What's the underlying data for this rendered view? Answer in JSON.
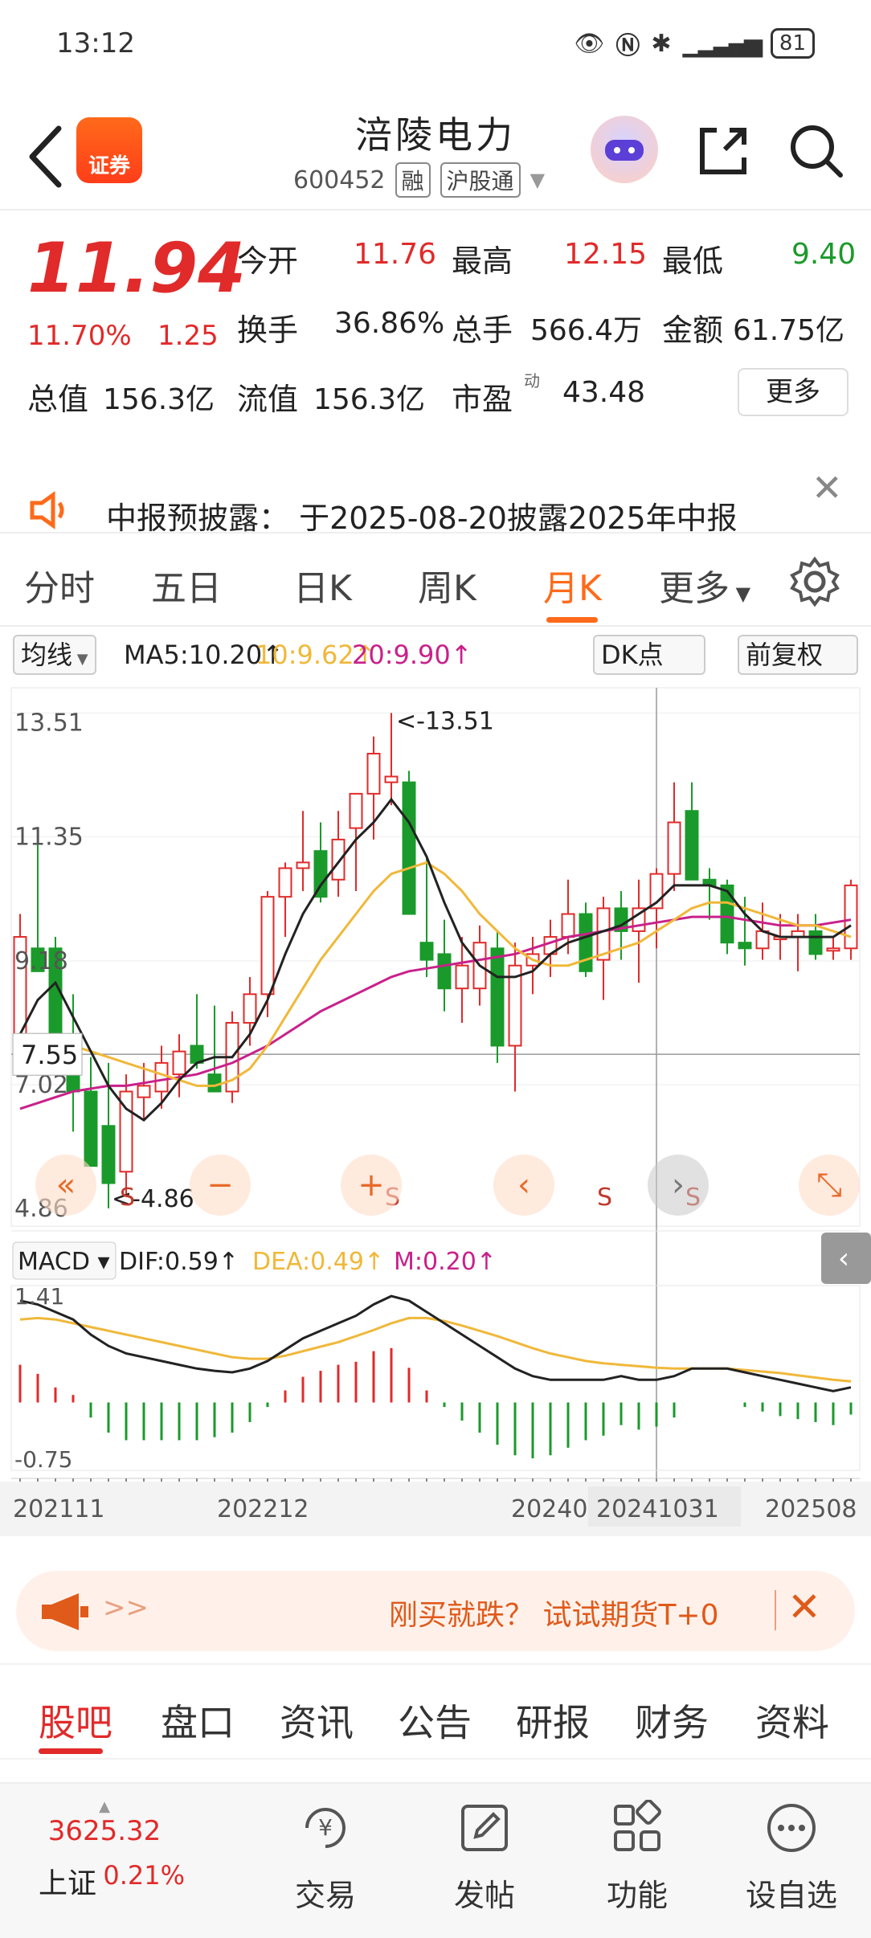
{
  "status_bar": {
    "time": "13:12",
    "battery": "81"
  },
  "header": {
    "broker_badge": "证券",
    "stock_name": "涪陵电力",
    "stock_code": "600452",
    "tag_margin": "融",
    "tag_connect": "沪股通"
  },
  "quote": {
    "price": "11.94",
    "change_pct": "11.70%",
    "change_amt": "1.25",
    "open_label": "今开",
    "open": "11.76",
    "high_label": "最高",
    "high": "12.15",
    "low_label": "最低",
    "low": "9.40",
    "turnover_label": "换手",
    "turnover": "36.86%",
    "volume_label": "总手",
    "volume": "566.4万",
    "amount_label": "金额",
    "amount": "61.75亿",
    "mktcap_label": "总值",
    "mktcap": "156.3亿",
    "float_label": "流值",
    "float_cap": "156.3亿",
    "pe_label": "市盈",
    "pe_sup": "动",
    "pe": "43.48",
    "more_label": "更多"
  },
  "notice": {
    "text": "中报预披露： 于2025-08-20披露2025年中报"
  },
  "period_tabs": [
    "分时",
    "五日",
    "日K",
    "周K",
    "月K",
    "更多"
  ],
  "active_period": "月K",
  "indicator_bar": {
    "ma_dropdown": "均线",
    "ma5": "MA5:10.20↑",
    "ma10": "10:9.62↑",
    "ma20": "20:9.90↑",
    "dk_button": "DK点",
    "adjust_button": "前复权"
  },
  "chart_data": {
    "type": "candlestick",
    "price_ticks": [
      "13.51",
      "11.35",
      "9.18",
      "7.02",
      "4.86"
    ],
    "crosshair_price": "7.55",
    "high_marker": "<-13.51",
    "low_marker": "<-4.86",
    "x_ticks": [
      "202111",
      "202212",
      "20240",
      "20241031",
      "202508"
    ],
    "ohlc": [
      {
        "o": 7.6,
        "h": 10.0,
        "l": 7.4,
        "c": 9.6
      },
      {
        "o": 9.4,
        "h": 11.5,
        "l": 9.0,
        "c": 9.0
      },
      {
        "o": 9.4,
        "h": 9.6,
        "l": 7.5,
        "c": 7.6
      },
      {
        "o": 7.6,
        "h": 8.6,
        "l": 6.2,
        "c": 6.9
      },
      {
        "o": 6.9,
        "h": 7.5,
        "l": 5.6,
        "c": 5.6
      },
      {
        "o": 6.3,
        "h": 7.4,
        "l": 4.86,
        "c": 5.3
      },
      {
        "o": 5.5,
        "h": 7.2,
        "l": 5.1,
        "c": 6.9
      },
      {
        "o": 6.8,
        "h": 7.4,
        "l": 6.4,
        "c": 7.0
      },
      {
        "o": 6.9,
        "h": 7.7,
        "l": 6.6,
        "c": 7.4
      },
      {
        "o": 7.2,
        "h": 7.9,
        "l": 6.8,
        "c": 7.6
      },
      {
        "o": 7.7,
        "h": 8.6,
        "l": 7.3,
        "c": 7.4
      },
      {
        "o": 7.2,
        "h": 8.4,
        "l": 6.9,
        "c": 6.9
      },
      {
        "o": 6.9,
        "h": 8.3,
        "l": 6.7,
        "c": 8.1
      },
      {
        "o": 8.1,
        "h": 8.9,
        "l": 7.7,
        "c": 8.6
      },
      {
        "o": 8.6,
        "h": 10.4,
        "l": 8.2,
        "c": 10.3
      },
      {
        "o": 10.3,
        "h": 10.9,
        "l": 9.6,
        "c": 10.8
      },
      {
        "o": 10.8,
        "h": 11.8,
        "l": 10.4,
        "c": 10.9
      },
      {
        "o": 11.1,
        "h": 11.6,
        "l": 10.2,
        "c": 10.3
      },
      {
        "o": 10.6,
        "h": 11.8,
        "l": 10.3,
        "c": 11.3
      },
      {
        "o": 11.5,
        "h": 12.1,
        "l": 10.4,
        "c": 12.1
      },
      {
        "o": 12.1,
        "h": 13.1,
        "l": 11.3,
        "c": 12.8
      },
      {
        "o": 12.3,
        "h": 13.51,
        "l": 11.9,
        "c": 12.4
      },
      {
        "o": 12.3,
        "h": 12.5,
        "l": 10.0,
        "c": 10.0
      },
      {
        "o": 9.5,
        "h": 11.0,
        "l": 8.9,
        "c": 9.2
      },
      {
        "o": 9.3,
        "h": 9.9,
        "l": 8.3,
        "c": 8.7
      },
      {
        "o": 8.7,
        "h": 9.6,
        "l": 8.1,
        "c": 9.1
      },
      {
        "o": 8.7,
        "h": 9.8,
        "l": 8.4,
        "c": 9.5
      },
      {
        "o": 9.4,
        "h": 9.7,
        "l": 7.4,
        "c": 7.7
      },
      {
        "o": 7.7,
        "h": 9.5,
        "l": 6.9,
        "c": 9.1
      },
      {
        "o": 9.1,
        "h": 9.6,
        "l": 8.6,
        "c": 9.3
      },
      {
        "o": 9.3,
        "h": 9.9,
        "l": 8.9,
        "c": 9.6
      },
      {
        "o": 9.6,
        "h": 10.6,
        "l": 9.3,
        "c": 10.0
      },
      {
        "o": 10.0,
        "h": 10.2,
        "l": 8.9,
        "c": 9.0
      },
      {
        "o": 9.2,
        "h": 10.3,
        "l": 8.5,
        "c": 10.1
      },
      {
        "o": 10.1,
        "h": 10.4,
        "l": 9.2,
        "c": 9.7
      },
      {
        "o": 9.7,
        "h": 10.6,
        "l": 8.8,
        "c": 10.1
      },
      {
        "o": 10.1,
        "h": 10.8,
        "l": 9.4,
        "c": 10.7
      },
      {
        "o": 10.7,
        "h": 12.3,
        "l": 10.4,
        "c": 11.6
      },
      {
        "o": 11.8,
        "h": 12.3,
        "l": 10.6,
        "c": 10.6
      },
      {
        "o": 10.6,
        "h": 10.8,
        "l": 9.9,
        "c": 10.5
      },
      {
        "o": 10.5,
        "h": 10.6,
        "l": 9.3,
        "c": 9.5
      },
      {
        "o": 9.5,
        "h": 10.3,
        "l": 9.1,
        "c": 9.4
      },
      {
        "o": 9.4,
        "h": 10.2,
        "l": 9.2,
        "c": 9.7
      },
      {
        "o": 9.6,
        "h": 10.0,
        "l": 9.2,
        "c": 9.6
      },
      {
        "o": 9.6,
        "h": 10.0,
        "l": 9.0,
        "c": 9.7
      },
      {
        "o": 9.7,
        "h": 10.0,
        "l": 9.2,
        "c": 9.3
      },
      {
        "o": 9.4,
        "h": 9.6,
        "l": 9.2,
        "c": 9.4
      },
      {
        "o": 9.4,
        "h": 10.6,
        "l": 9.2,
        "c": 10.5
      }
    ],
    "ma5": [
      7.9,
      8.5,
      8.8,
      8.2,
      7.6,
      7.0,
      6.6,
      6.4,
      6.7,
      7.1,
      7.4,
      7.5,
      7.5,
      7.9,
      8.5,
      9.3,
      10.0,
      10.5,
      10.9,
      11.3,
      11.6,
      12.0,
      11.6,
      11.0,
      10.2,
      9.5,
      9.1,
      8.9,
      8.9,
      9.0,
      9.3,
      9.5,
      9.6,
      9.7,
      9.8,
      10.0,
      10.2,
      10.5,
      10.5,
      10.5,
      10.4,
      10.0,
      9.7,
      9.6,
      9.6,
      9.6,
      9.6,
      9.8
    ],
    "ma10": [
      7.6,
      7.7,
      7.8,
      7.7,
      7.6,
      7.5,
      7.4,
      7.3,
      7.2,
      7.1,
      7.0,
      7.0,
      7.1,
      7.3,
      7.7,
      8.2,
      8.7,
      9.2,
      9.6,
      10.0,
      10.4,
      10.7,
      10.8,
      10.9,
      10.7,
      10.4,
      10.0,
      9.7,
      9.4,
      9.2,
      9.1,
      9.1,
      9.2,
      9.3,
      9.4,
      9.5,
      9.7,
      9.9,
      10.1,
      10.2,
      10.2,
      10.1,
      10.0,
      9.9,
      9.8,
      9.8,
      9.7,
      9.6
    ],
    "ma20": [
      6.6,
      6.7,
      6.8,
      6.9,
      6.95,
      7.0,
      7.0,
      7.05,
      7.1,
      7.15,
      7.2,
      7.3,
      7.4,
      7.55,
      7.7,
      7.9,
      8.1,
      8.3,
      8.45,
      8.6,
      8.75,
      8.9,
      9.0,
      9.05,
      9.1,
      9.15,
      9.2,
      9.25,
      9.3,
      9.4,
      9.5,
      9.6,
      9.65,
      9.7,
      9.75,
      9.8,
      9.85,
      9.9,
      9.95,
      9.95,
      9.95,
      9.9,
      9.85,
      9.8,
      9.8,
      9.8,
      9.85,
      9.9
    ],
    "macd_ticks": [
      "1.41",
      "-0.75"
    ],
    "dif": [
      1.35,
      1.3,
      1.2,
      1.1,
      0.9,
      0.75,
      0.65,
      0.6,
      0.55,
      0.5,
      0.45,
      0.42,
      0.4,
      0.45,
      0.55,
      0.7,
      0.85,
      0.95,
      1.05,
      1.15,
      1.3,
      1.41,
      1.35,
      1.2,
      1.05,
      0.9,
      0.75,
      0.6,
      0.45,
      0.35,
      0.3,
      0.3,
      0.3,
      0.3,
      0.35,
      0.3,
      0.3,
      0.35,
      0.45,
      0.45,
      0.45,
      0.4,
      0.35,
      0.3,
      0.25,
      0.2,
      0.15,
      0.2
    ],
    "dea": [
      1.1,
      1.12,
      1.1,
      1.05,
      1.0,
      0.95,
      0.9,
      0.85,
      0.8,
      0.75,
      0.7,
      0.65,
      0.6,
      0.58,
      0.58,
      0.62,
      0.68,
      0.74,
      0.8,
      0.88,
      0.96,
      1.05,
      1.12,
      1.12,
      1.08,
      1.02,
      0.95,
      0.88,
      0.8,
      0.72,
      0.65,
      0.6,
      0.55,
      0.52,
      0.5,
      0.48,
      0.46,
      0.45,
      0.45,
      0.45,
      0.45,
      0.43,
      0.41,
      0.39,
      0.36,
      0.33,
      0.3,
      0.28
    ],
    "macd_hist": [
      0.5,
      0.38,
      0.2,
      0.1,
      -0.2,
      -0.4,
      -0.5,
      -0.5,
      -0.5,
      -0.5,
      -0.5,
      -0.46,
      -0.4,
      -0.26,
      -0.06,
      0.16,
      0.34,
      0.42,
      0.5,
      0.54,
      0.68,
      0.72,
      0.46,
      0.16,
      -0.06,
      -0.24,
      -0.4,
      -0.56,
      -0.7,
      -0.74,
      -0.7,
      -0.6,
      -0.5,
      -0.44,
      -0.3,
      -0.36,
      -0.32,
      -0.2,
      0.0,
      0.0,
      0.0,
      -0.06,
      -0.12,
      -0.18,
      -0.22,
      -0.26,
      -0.3,
      -0.16
    ],
    "macd_labels": {
      "selector": "MACD",
      "dif": "DIF:0.59↑",
      "dea": "DEA:0.49↑",
      "m": "M:0.20↑"
    }
  },
  "banner": {
    "text": "刚买就跌？ 试试期货T+0"
  },
  "content_tabs": [
    "股吧",
    "盘口",
    "资讯",
    "公告",
    "研报",
    "财务",
    "资料"
  ],
  "active_content_tab": "股吧",
  "bottom_nav": {
    "index_value": "3625.32",
    "index_name": "上证",
    "index_change": "0.21%",
    "items": [
      "交易",
      "发帖",
      "功能",
      "设自选"
    ]
  },
  "colors": {
    "up": "#e12a2a",
    "down": "#1a9a2a",
    "accent": "#ff6a1a",
    "ma5": "#222222",
    "ma10": "#f0b83a",
    "ma20": "#c8218a"
  }
}
